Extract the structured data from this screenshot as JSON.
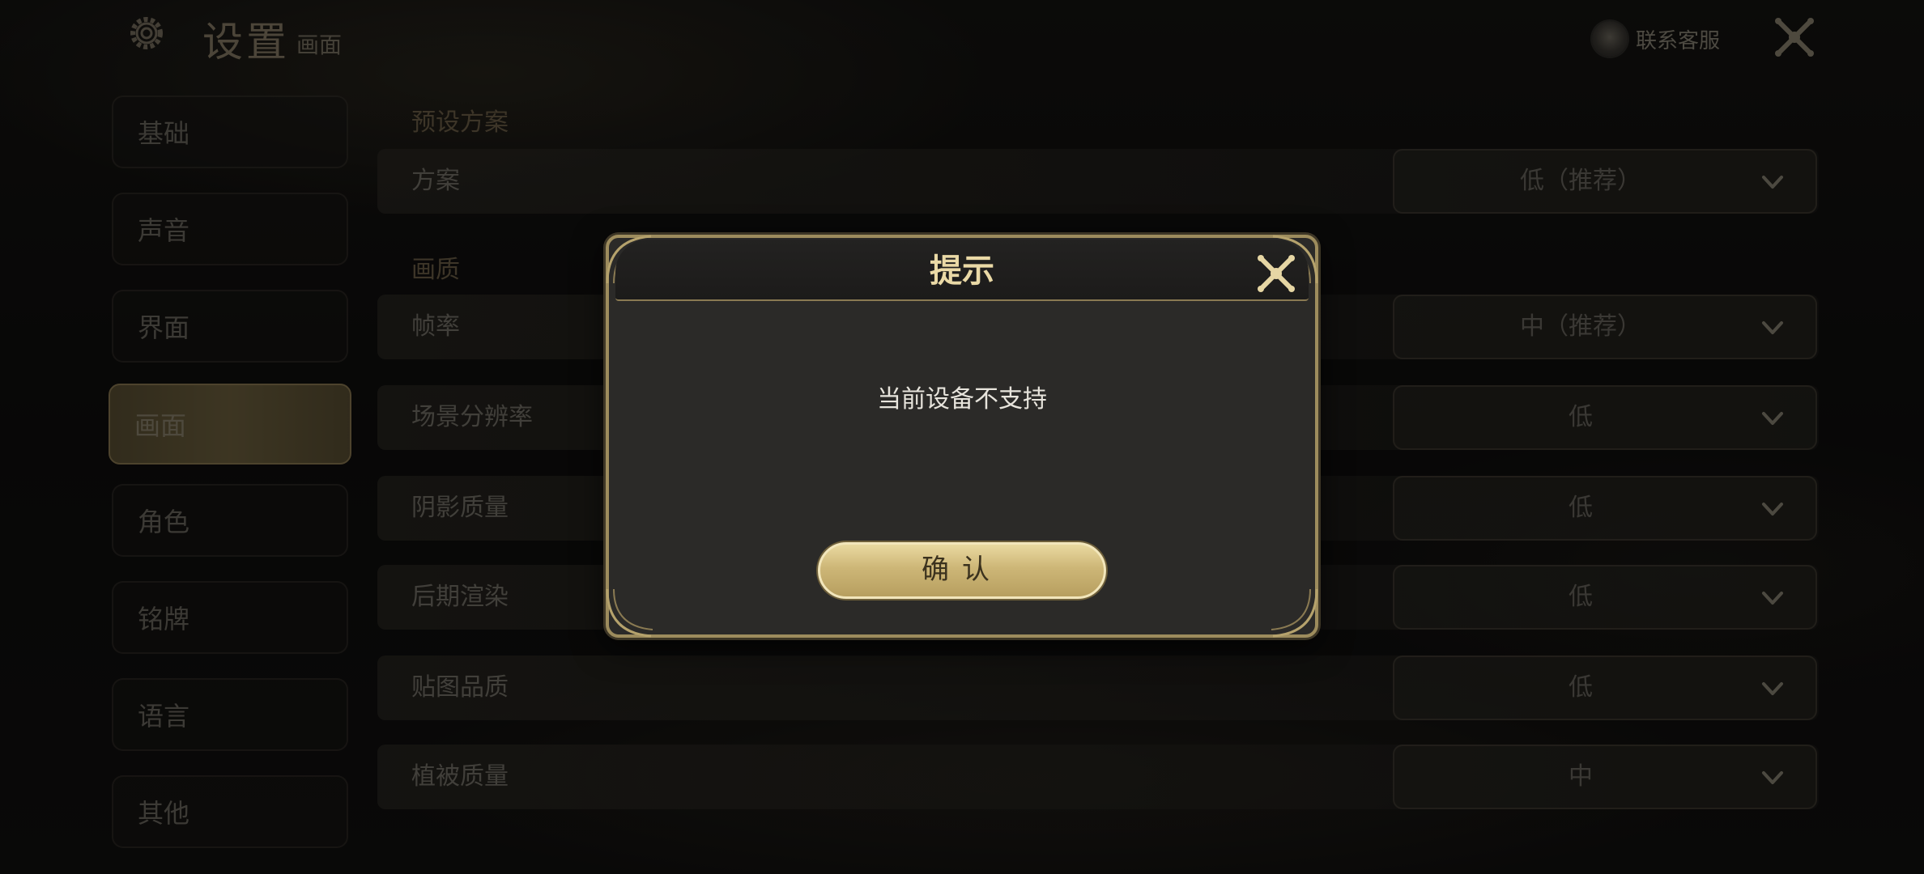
{
  "header": {
    "title": "设置",
    "subtitle": "画面",
    "customer_service": "联系客服",
    "gear_icon": "gear-icon",
    "close_icon": "close-icon"
  },
  "sidebar": {
    "items": [
      {
        "label": "基础",
        "active": false
      },
      {
        "label": "声音",
        "active": false
      },
      {
        "label": "界面",
        "active": false
      },
      {
        "label": "画面",
        "active": true
      },
      {
        "label": "角色",
        "active": false
      },
      {
        "label": "铭牌",
        "active": false
      },
      {
        "label": "语言",
        "active": false
      },
      {
        "label": "其他",
        "active": false
      }
    ]
  },
  "sections": {
    "preset": "预设方案",
    "quality": "画质"
  },
  "settings": [
    {
      "label": "方案",
      "value": "低（推荐）"
    },
    {
      "label": "帧率",
      "value": "中（推荐）"
    },
    {
      "label": "场景分辨率",
      "value": "低"
    },
    {
      "label": "阴影质量",
      "value": "低"
    },
    {
      "label": "后期渲染",
      "value": "低"
    },
    {
      "label": "贴图品质",
      "value": "低"
    },
    {
      "label": "植被质量",
      "value": "中"
    }
  ],
  "modal": {
    "title": "提示",
    "message": "当前设备不支持",
    "confirm_label": "确认"
  },
  "colors": {
    "accent_gold": "#cdb677",
    "frame_gold": "#9d8c5d",
    "background": "#0f0e0d"
  }
}
